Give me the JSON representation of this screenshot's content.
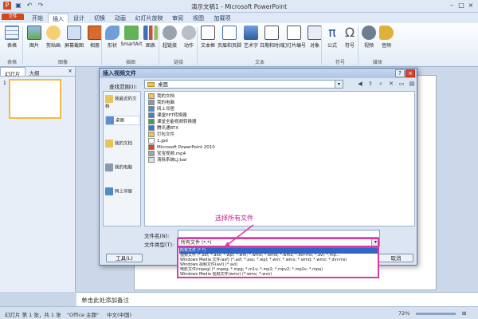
{
  "window": {
    "title": "演示文稿1 - Microsoft PowerPoint"
  },
  "tabs": [
    "文件",
    "开始",
    "插入",
    "设计",
    "切换",
    "动画",
    "幻灯片放映",
    "审阅",
    "视图",
    "加载项"
  ],
  "ribbon": {
    "buttons": [
      "表格",
      "图片",
      "剪贴画",
      "屏幕截图",
      "相册",
      "形状",
      "SmartArt",
      "图表",
      "超链接",
      "动作",
      "文本框",
      "页眉和页脚",
      "艺术字",
      "日期和时间",
      "幻灯片编号",
      "对象",
      "公式",
      "符号",
      "视频",
      "音频"
    ],
    "groups": [
      "表格",
      "图像",
      "插图",
      "链接",
      "文本",
      "符号",
      "媒体"
    ]
  },
  "left_pane": {
    "tab_slides": "幻灯片",
    "tab_outline": "大纲",
    "slide_number": "1"
  },
  "notes": {
    "placeholder": "单击此处添加备注"
  },
  "status": {
    "slide": "幻灯片 第 1 张，共 1 张",
    "theme": "\"Office 主题\"",
    "language": "中文(中国)",
    "zoom": "72%"
  },
  "dialog": {
    "title": "插入视频文件",
    "look_in_label": "查找范围(I):",
    "look_in_value": "桌面",
    "places": [
      "我最近的文档",
      "桌面",
      "我的文档",
      "我的电脑",
      "网上邻居"
    ],
    "files": [
      "我的文档",
      "我的电脑",
      "网上邻居",
      "课堂PPT转换器",
      "课堂全能视频转换器",
      "腾讯通RTX",
      "打包文件",
      "1.jpd",
      "Microsoft PowerPoint 2010",
      "宝宝视频.mp4",
      "清除系统LJ.bat"
    ],
    "filename_label": "文件名(N):",
    "filetype_label": "文件类型(T):",
    "filetype_value": "所有文件 (*.*)",
    "tools_button": "工具(L)",
    "cancel_button": "取消",
    "filetype_options": [
      "所有文件 (*.*)",
      "视频文件 (*.asf; *.asx; *.wpl; *.wm; *.wmx; *.wmd; *.wmz; *.dvr-ms; *.avi; *.mp...",
      "Windows Media 文件(asf) (*.asf; *.asx; *.wpl; *.wm; *.wmx; *.wmd; *.wmz; *.dvr-ms)",
      "Windows 视频文件(avi) (*.avi)",
      "电影文件(mpeg) (*.mpeg; *.mpg; *.m1v; *.mp2; *.mpv2; *.mp2v; *.mpa)",
      "Windows Media 视频文件(wmv) (*.wmv; *.wvx)"
    ]
  },
  "annotation": "选择所有文件"
}
